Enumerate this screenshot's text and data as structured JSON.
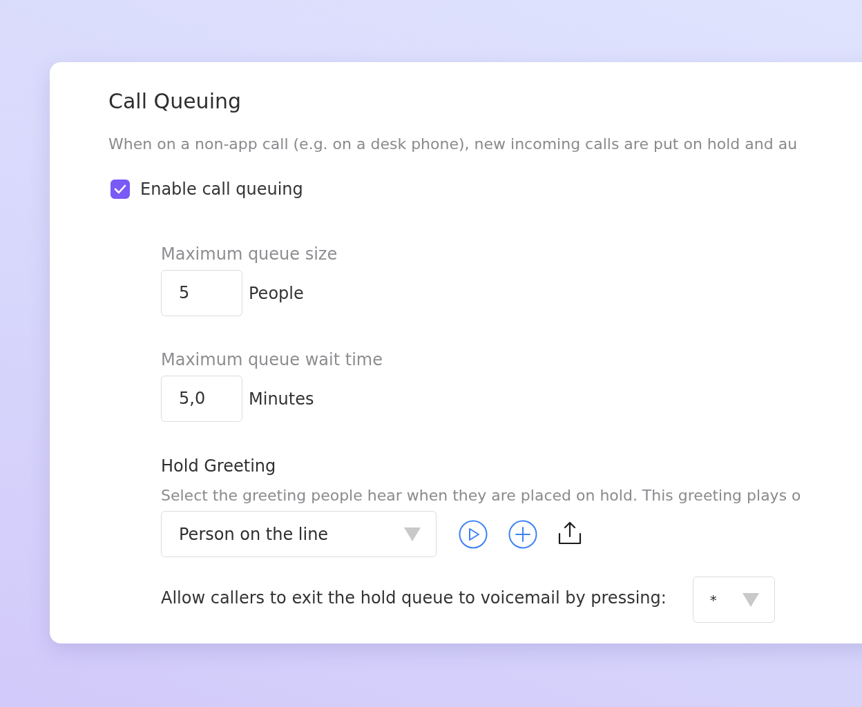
{
  "section": {
    "title": "Call Queuing",
    "description": "When on a non-app call (e.g. on a desk phone), new incoming calls are put on hold and au"
  },
  "enable": {
    "label": "Enable call queuing",
    "checked": true
  },
  "fields": [
    {
      "label": "Maximum queue size",
      "value": "5",
      "unit": "People"
    },
    {
      "label": "Maximum queue wait time",
      "value": "5,0",
      "unit": "Minutes"
    }
  ],
  "hold_greeting": {
    "title": "Hold Greeting",
    "description": "Select the greeting people hear when they are placed on hold. This greeting plays o",
    "select": {
      "value": "Person on the line"
    }
  },
  "exit_option": {
    "label": "Allow callers to exit the hold queue to voicemail by pressing:",
    "select": {
      "value": "*"
    }
  }
}
